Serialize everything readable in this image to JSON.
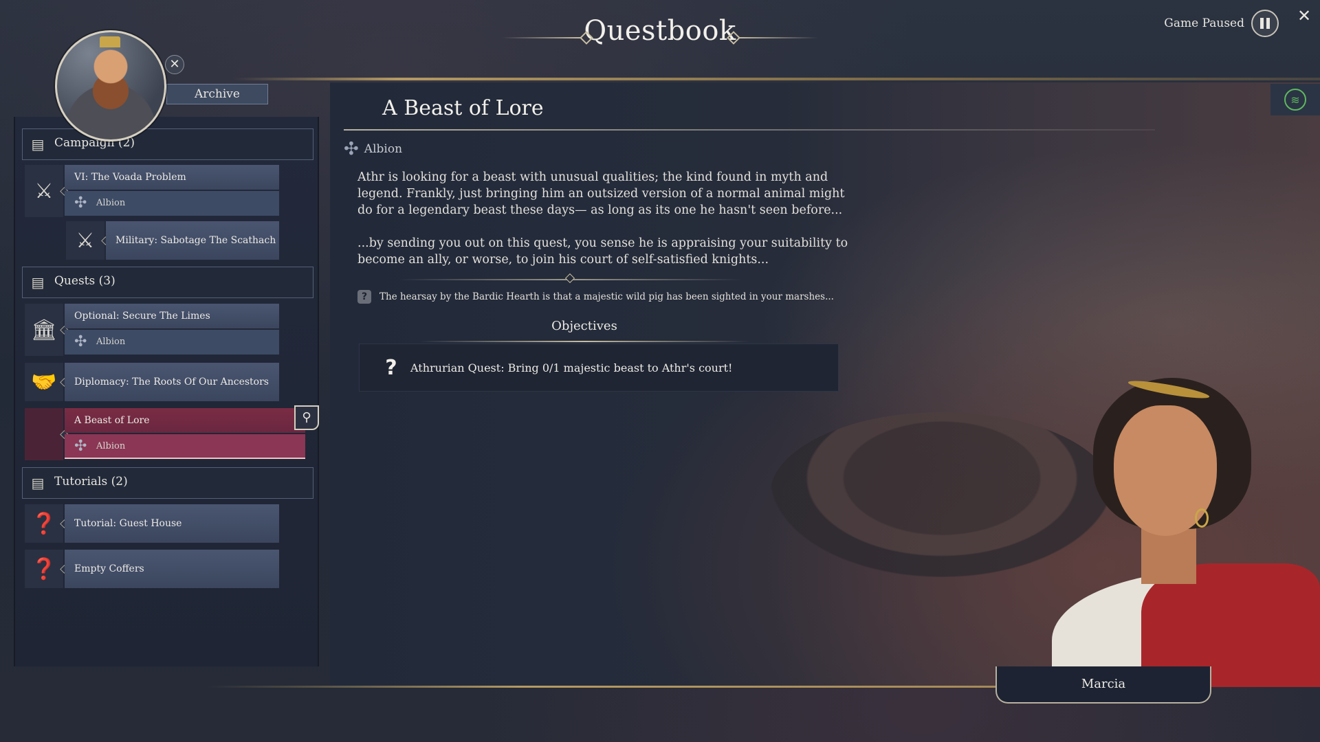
{
  "header": {
    "title": "Questbook",
    "paused_label": "Game Paused"
  },
  "archive_label": "Archive",
  "sidebar": {
    "sections": [
      {
        "label": "Campaign (2)"
      },
      {
        "label": "Quests (3)"
      },
      {
        "label": "Tutorials (2)"
      }
    ],
    "campaign": [
      {
        "title": "VI: The Voada Problem",
        "sub": "Albion"
      },
      {
        "title": "Military: Sabotage The Scathach"
      }
    ],
    "quests": [
      {
        "title": "Optional: Secure The Limes",
        "sub": "Albion"
      },
      {
        "title": "Diplomacy: The Roots Of Our Ancestors"
      },
      {
        "title": "A Beast of Lore",
        "sub": "Albion"
      }
    ],
    "tutorials": [
      {
        "title": "Tutorial: Guest House"
      },
      {
        "title": "Empty Coffers"
      }
    ]
  },
  "main": {
    "quest_title": "A Beast of Lore",
    "region": "Albion",
    "description": [
      "Athr is looking for a beast with unusual qualities; the kind found in myth and legend. Frankly, just bringing him an outsized version of a normal animal might do for a legendary beast these days— as long as its one he hasn't seen before...",
      "...by sending you out on this quest, you sense he is appraising your suitability to become an ally, or worse, to join his court of self-satisfied knights..."
    ],
    "hint": "The hearsay by the Bardic Hearth is that a majestic wild pig has been sighted in your marshes...",
    "objectives_title": "Objectives",
    "objective": "Athrurian Quest: Bring 0/1 majestic beast to Athr's court!"
  },
  "advisor_name": "Marcia"
}
